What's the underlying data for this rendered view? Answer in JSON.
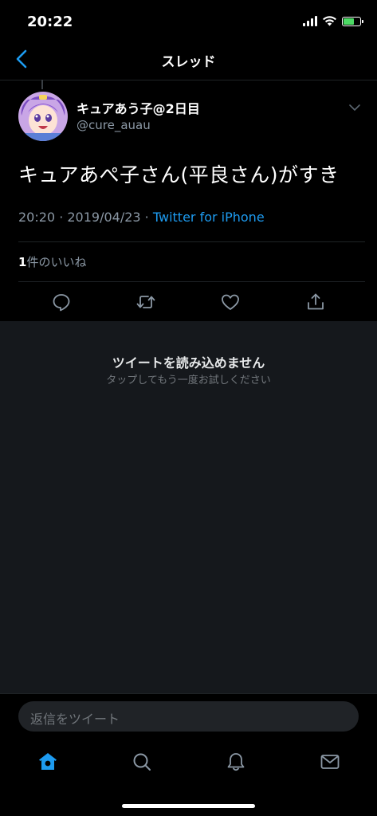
{
  "status": {
    "time": "20:22"
  },
  "nav": {
    "title": "スレッド"
  },
  "tweet": {
    "display_name": "キュアあう子@2日目",
    "handle": "@cure_auau",
    "text": "キュアあぺ子さん(平良さん)がすき",
    "time": "20:20",
    "sep": " · ",
    "date": "2019/04/23",
    "sep2": " · ",
    "source": "Twitter for iPhone",
    "like_count": "1",
    "like_label": "件のいいね"
  },
  "unavailable": {
    "title": "ツイートを読み込めません",
    "subtitle": "タップしてもう一度お試しください"
  },
  "reply": {
    "placeholder": "返信をツイート"
  },
  "icons": [
    "back-chevron",
    "reply-icon",
    "retweet-icon",
    "like-icon",
    "share-icon",
    "home-icon",
    "search-icon",
    "notifications-icon",
    "messages-icon"
  ],
  "colors": {
    "accent": "#1d9bf0",
    "background": "#000000",
    "panel": "#15181c"
  }
}
